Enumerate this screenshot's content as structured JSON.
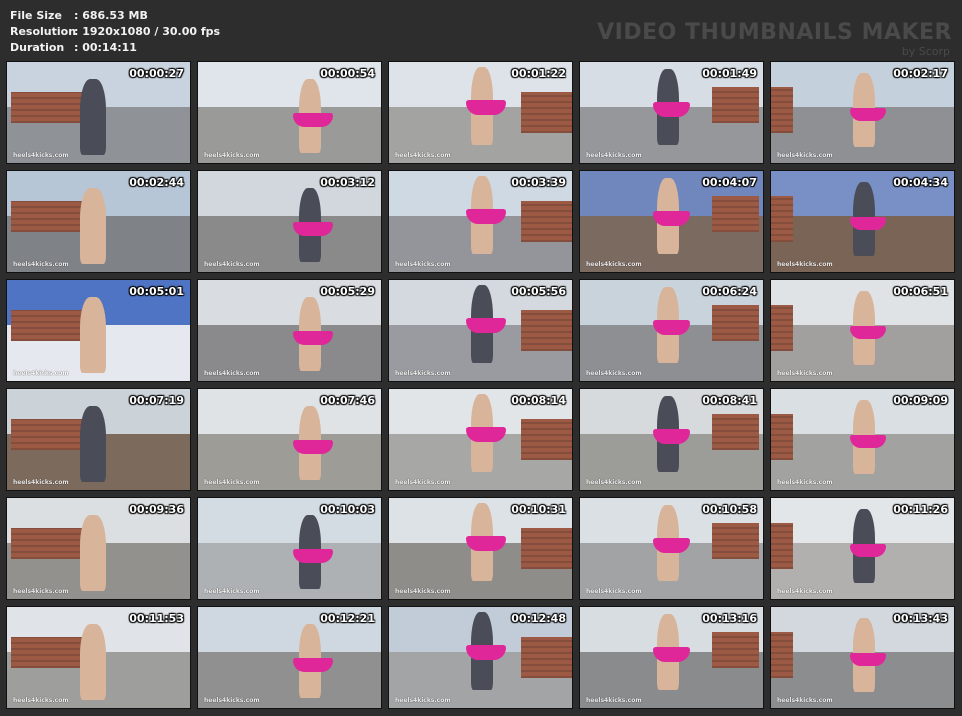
{
  "info": {
    "file_size_label": "File Size",
    "file_size_value": ": 686.53 MB",
    "resolution_label": "Resolution",
    "resolution_value": ": 1920x1080 / 30.00 fps",
    "duration_label": "Duration",
    "duration_value": ": 00:14:11"
  },
  "brand": {
    "title": "VIDEO THUMBNAILS MAKER",
    "subtitle": "by Scorp"
  },
  "watermark": "heels4kicks.com",
  "thumbnails": [
    {
      "time": "00:00:27",
      "sky": "#c9d3df",
      "roof": "#8f9398"
    },
    {
      "time": "00:00:54",
      "sky": "#dfe5ea",
      "roof": "#9a9a98"
    },
    {
      "time": "00:01:22",
      "sky": "#dde3e8",
      "roof": "#a3a3a1"
    },
    {
      "time": "00:01:49",
      "sky": "#d7dde4",
      "roof": "#96979a"
    },
    {
      "time": "00:02:17",
      "sky": "#c4d0db",
      "roof": "#8e9094"
    },
    {
      "time": "00:02:44",
      "sky": "#b7c6d6",
      "roof": "#7f8287"
    },
    {
      "time": "00:03:12",
      "sky": "#d1d7dc",
      "roof": "#8a8a8a"
    },
    {
      "time": "00:03:39",
      "sky": "#cfd9e3",
      "roof": "#93959a"
    },
    {
      "time": "00:04:07",
      "sky": "#6f87bd",
      "roof": "#7b6a60"
    },
    {
      "time": "00:04:34",
      "sky": "#7990c7",
      "roof": "#7a6456"
    },
    {
      "time": "00:05:01",
      "sky": "#4f74c4",
      "roof": "#e5e8ee"
    },
    {
      "time": "00:05:29",
      "sky": "#d9dde1",
      "roof": "#8a8a8c"
    },
    {
      "time": "00:05:56",
      "sky": "#d3d9df",
      "roof": "#9a9ba0"
    },
    {
      "time": "00:06:24",
      "sky": "#c9d3dc",
      "roof": "#8d8f93"
    },
    {
      "time": "00:06:51",
      "sky": "#dfe3e6",
      "roof": "#a1a09e"
    },
    {
      "time": "00:07:19",
      "sky": "#cbd2d8",
      "roof": "#7c6a5c"
    },
    {
      "time": "00:07:46",
      "sky": "#dfe3e6",
      "roof": "#9e9c97"
    },
    {
      "time": "00:08:14",
      "sky": "#e2e5e8",
      "roof": "#a7a7a5"
    },
    {
      "time": "00:08:41",
      "sky": "#d7dadd",
      "roof": "#9c9c99"
    },
    {
      "time": "00:09:09",
      "sky": "#dadfe3",
      "roof": "#a2a2a1"
    },
    {
      "time": "00:09:36",
      "sky": "#dcdfe2",
      "roof": "#93918e"
    },
    {
      "time": "00:10:03",
      "sky": "#d3dbe3",
      "roof": "#aeb1b4"
    },
    {
      "time": "00:10:31",
      "sky": "#dde2e6",
      "roof": "#8e8d8a"
    },
    {
      "time": "00:10:58",
      "sky": "#dbe0e5",
      "roof": "#a2a3a5"
    },
    {
      "time": "00:11:26",
      "sky": "#e3e6e9",
      "roof": "#b1b0ae"
    },
    {
      "time": "00:11:53",
      "sky": "#e0e4e8",
      "roof": "#9e9e9c"
    },
    {
      "time": "00:12:21",
      "sky": "#cfd8e0",
      "roof": "#8f908f"
    },
    {
      "time": "00:12:48",
      "sky": "#c1ccd8",
      "roof": "#a3a4a6"
    },
    {
      "time": "00:13:16",
      "sky": "#d8dde2",
      "roof": "#8a8b8c"
    },
    {
      "time": "00:13:43",
      "sky": "#d2d8de",
      "roof": "#8c8d8f"
    }
  ]
}
